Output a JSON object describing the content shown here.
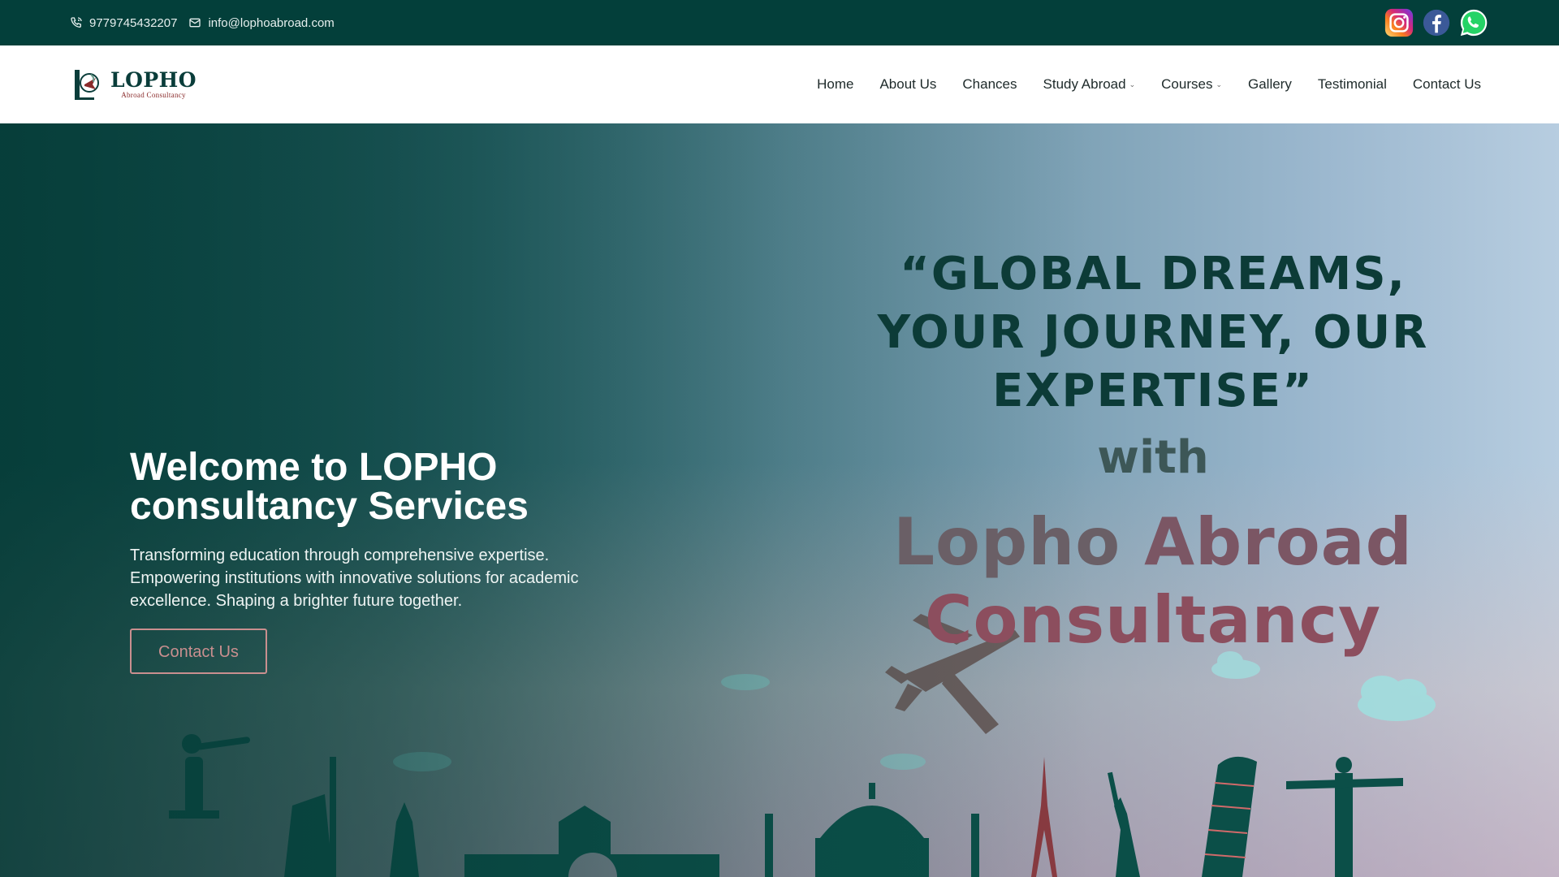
{
  "topbar": {
    "phone": "9779745432207",
    "email": "info@lophoabroad.com",
    "social": [
      {
        "name": "instagram-icon",
        "color": "#d6249f"
      },
      {
        "name": "facebook-icon",
        "color": "#3b5998"
      },
      {
        "name": "whatsapp-icon",
        "color": "#25d366"
      }
    ]
  },
  "brand": {
    "name": "LOPHO",
    "tagline": "Abroad Consultancy",
    "primary_color": "#033f3a",
    "accent_color": "#8a2b2b"
  },
  "nav": {
    "items": [
      {
        "label": "Home",
        "dropdown": false
      },
      {
        "label": "About Us",
        "dropdown": false
      },
      {
        "label": "Chances",
        "dropdown": false
      },
      {
        "label": "Study Abroad",
        "dropdown": true
      },
      {
        "label": "Courses",
        "dropdown": true
      },
      {
        "label": "Gallery",
        "dropdown": false
      },
      {
        "label": "Testimonial",
        "dropdown": false
      },
      {
        "label": "Contact Us",
        "dropdown": false
      }
    ],
    "caret": "⌄"
  },
  "hero": {
    "tagline_line1": "“GLOBAL DREAMS,",
    "tagline_line2": "YOUR JOURNEY, OUR EXPERTISE”",
    "tagline_with": "with",
    "tagline_brand_1": "Lopho",
    "tagline_brand_2": "Abroad",
    "tagline_brand_3": "Consultancy",
    "title_line1": "Welcome to LOPHO",
    "title_line2": "consultancy Services",
    "description": "Transforming education through comprehensive expertise. Empowering institutions with innovative solutions for academic excellence. Shaping a brighter future together.",
    "cta_label": "Contact Us"
  }
}
